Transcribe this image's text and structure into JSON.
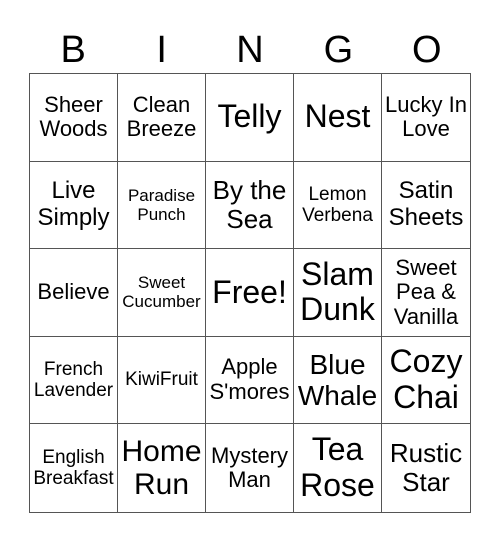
{
  "header": [
    "B",
    "I",
    "N",
    "G",
    "O"
  ],
  "cells": [
    "Sheer Woods",
    "Clean Breeze",
    "Telly",
    "Nest",
    "Lucky In Love",
    "Live Simply",
    "Paradise Punch",
    "By the Sea",
    "Lemon Verbena",
    "Satin Sheets",
    "Believe",
    "Sweet Cucumber",
    "Free!",
    "Slam Dunk",
    "Sweet Pea & Vanilla",
    "French Lavender",
    "KiwiFruit",
    "Apple S'mores",
    "Blue Whale",
    "Cozy Chai",
    "English Breakfast",
    "Home Run",
    "Mystery Man",
    "Tea Rose",
    "Rustic Star"
  ]
}
